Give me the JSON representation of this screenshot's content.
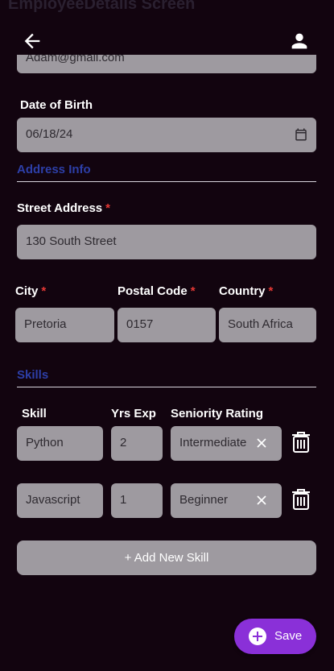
{
  "screen": {
    "title": "EmployeeDetails Screen"
  },
  "email": {
    "value": "Adam@gmail.com"
  },
  "dob": {
    "label": "Date of Birth",
    "value": "06/18/24"
  },
  "address": {
    "section_title": "Address Info",
    "street_label": "Street Address",
    "street_value": "130 South  Street",
    "city_label": "City",
    "city_value": "Pretoria",
    "postal_label": "Postal Code",
    "postal_value": "0157",
    "country_label": "Country",
    "country_value": "South Africa",
    "required_mark": "*"
  },
  "skills": {
    "section_title": "Skills",
    "col_skill": "Skill",
    "col_years": "Yrs Exp",
    "col_rating": "Seniority Rating",
    "rows": [
      {
        "skill": "Python",
        "years": "2",
        "rating": "Intermediate"
      },
      {
        "skill": "Javascript",
        "years": "1",
        "rating": "Beginner"
      }
    ],
    "add_label": "+ Add New Skill"
  },
  "actions": {
    "save_label": "Save"
  },
  "colors": {
    "accent": "#8a30d8",
    "section": "#2d3fa8",
    "required": "#e53935",
    "field_bg": "#9e9aa0"
  },
  "icons": {
    "back": "arrow-left-icon",
    "profile": "person-icon",
    "calendar": "calendar-icon",
    "clear": "close-icon",
    "delete": "trash-icon",
    "add": "plus-circle-icon"
  }
}
